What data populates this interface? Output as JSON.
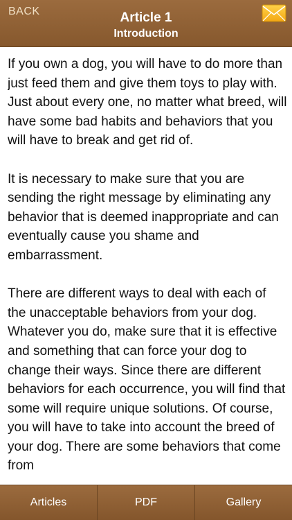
{
  "header": {
    "back_label": "BACK",
    "title": "Article 1",
    "subtitle": "Introduction",
    "mail_icon": "envelope-icon"
  },
  "article": {
    "paragraphs": [
      "If you own a dog, you will have to do more than just feed them and give them toys to play with. Just about every one, no matter what breed, will have some bad habits and behaviors that you will have to break and get rid of.",
      "It is necessary to make sure that you are sending the right message by eliminating any behavior that is deemed inappropriate and can eventually cause you shame and embarrassment.",
      "There are different ways to deal with each of the unacceptable behaviors from your dog. Whatever you do, make sure that it is effective and something that can force your dog to change their ways. Since there are different behaviors for each occurrence, you will find that some will require unique solutions. Of course, you will have to take into account the breed of your dog. There are some behaviors that come from"
    ]
  },
  "tabbar": {
    "items": [
      {
        "label": "Articles"
      },
      {
        "label": "PDF"
      },
      {
        "label": "Gallery"
      }
    ]
  },
  "colors": {
    "bar": "#8f6134",
    "text": "#111111"
  }
}
